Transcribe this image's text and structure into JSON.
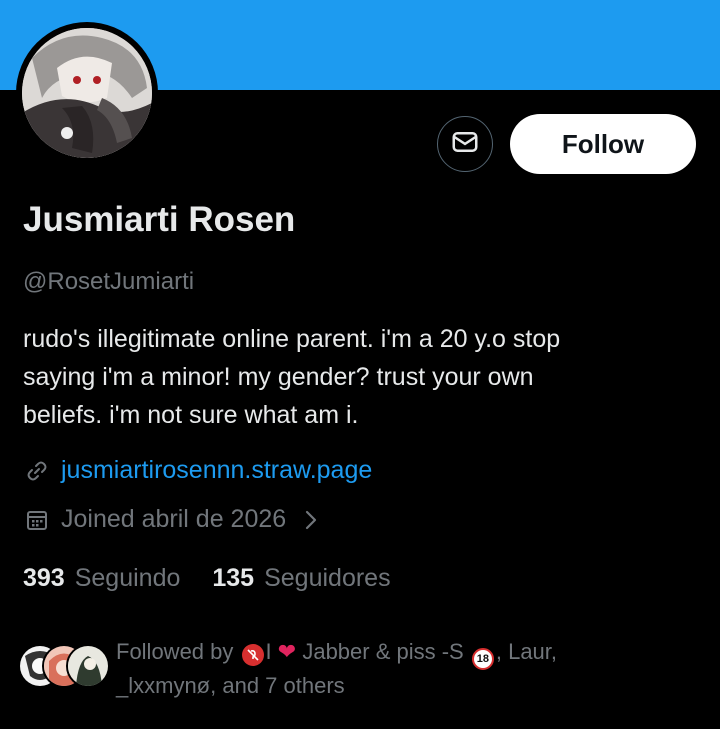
{
  "profile": {
    "name": "Jusmiarti Rosen",
    "handle": "@RosetJumiarti",
    "bio_lines": [
      "rudo's illegitimate online parent. i'm a 20 y.o stop",
      "saying i'm a minor! my gender? trust your own",
      "beliefs. i'm not sure what am i."
    ],
    "website": "jusmiartirosennn.straw.page",
    "joined": "Joined abril de 2026"
  },
  "actions": {
    "follow_label": "Follow",
    "message_icon": "mail-icon"
  },
  "stats": {
    "following_count": "393",
    "following_label": "Seguindo",
    "followers_count": "135",
    "followers_label": "Seguidores"
  },
  "followed_by": {
    "prefix": "Followed by",
    "name1_separator": "I",
    "name1_rest": "Jabber & piss -S",
    "after_18": ", Laur,",
    "line2": "_lxxmynø, and 7 others",
    "emoji_18_text": "18"
  },
  "colors": {
    "banner": "#1d9bf0",
    "link": "#1d9bf0",
    "muted": "#71767b",
    "text": "#e7e9ea"
  }
}
